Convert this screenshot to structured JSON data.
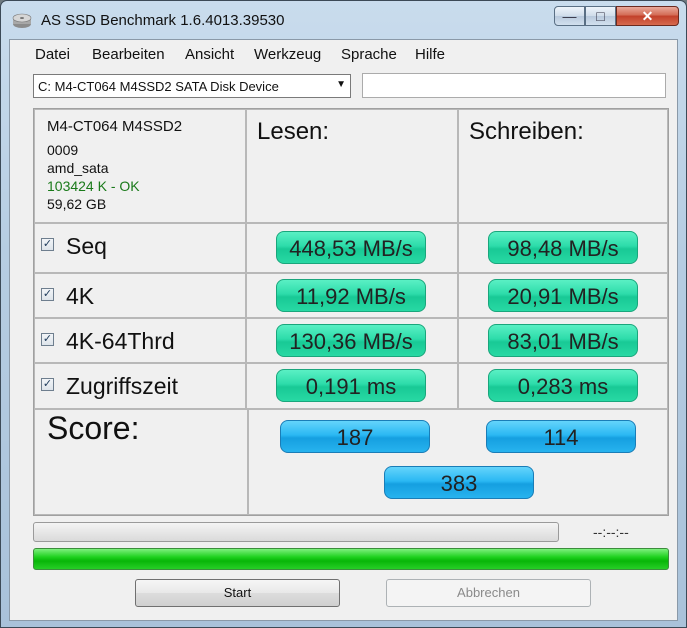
{
  "window": {
    "title": "AS SSD Benchmark 1.6.4013.39530",
    "controls": {
      "minimize": "—",
      "maximize": "□",
      "close": "✕"
    }
  },
  "menu": [
    "Datei",
    "Bearbeiten",
    "Ansicht",
    "Werkzeug",
    "Sprache",
    "Hilfe"
  ],
  "drive_select": {
    "value": "C: M4-CT064 M4SSD2 SATA Disk Device"
  },
  "info": {
    "model": "M4-CT064 M4SSD2",
    "firmware": "0009",
    "driver": "amd_sata",
    "alignment": "103424 K - OK",
    "size": "59,62 GB"
  },
  "columns": {
    "read": "Lesen:",
    "write": "Schreiben:"
  },
  "tests": [
    {
      "label": "Seq",
      "checked": true,
      "read": "448,53 MB/s",
      "write": "98,48 MB/s"
    },
    {
      "label": "4K",
      "checked": true,
      "read": "11,92 MB/s",
      "write": "20,91 MB/s"
    },
    {
      "label": "4K-64Thrd",
      "checked": true,
      "read": "130,36 MB/s",
      "write": "83,01 MB/s"
    },
    {
      "label": "Zugriffszeit",
      "checked": true,
      "read": "0,191 ms",
      "write": "0,283 ms"
    }
  ],
  "score": {
    "label": "Score:",
    "read": "187",
    "write": "114",
    "total": "383"
  },
  "progress": {
    "time": "--:--:--",
    "test_progress": 0,
    "overall_progress": 1.0
  },
  "buttons": {
    "start": "Start",
    "abort": "Abbrechen"
  },
  "colors": {
    "result_green": "#2ddcaa",
    "score_blue": "#2bb8f3",
    "ok_text": "#1a7a1a",
    "progress_green": "#1fd11f"
  }
}
